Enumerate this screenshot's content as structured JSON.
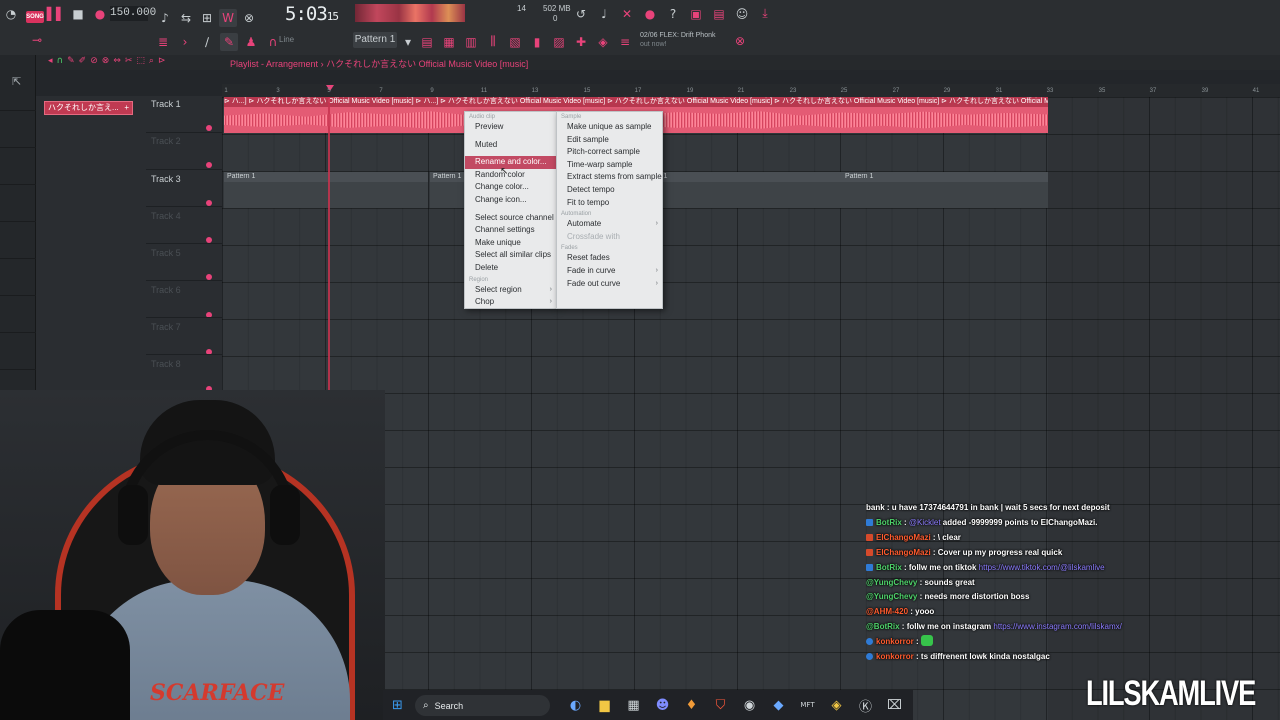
{
  "toolbar": {
    "song_badge": "SONG",
    "tempo": "150.000",
    "time_main": "5:03",
    "time_small": "15",
    "meter_a": "14",
    "meter_b": "502 MB",
    "meter_c": "0",
    "pattern": "Pattern 1",
    "line_mode": "Line",
    "hint_top": "02/06 FLEX: Drift Phonk",
    "hint_bottom": "out now!"
  },
  "playlist": {
    "title_prefix": "Playlist - Arrangement",
    "title_sep": "›",
    "title_song": "ハクそれしか言えない Official Music Video [music]",
    "pattern_picker": "ハクそれしか言え...",
    "pattern_picker_plus": "+"
  },
  "tracks": [
    {
      "label": "Track 1"
    },
    {
      "label": "Track 2"
    },
    {
      "label": "Track 3"
    },
    {
      "label": "Track 4"
    },
    {
      "label": "Track 5"
    },
    {
      "label": "Track 6"
    },
    {
      "label": "Track 7"
    },
    {
      "label": "Track 8"
    }
  ],
  "ruler_ticks": [
    "1",
    "3",
    "5",
    "7",
    "9",
    "11",
    "13",
    "15",
    "17",
    "19",
    "21",
    "23",
    "25",
    "27",
    "29",
    "31",
    "33",
    "35",
    "37",
    "39",
    "41"
  ],
  "audio_clip": {
    "caption": "⊳ ハ...]  ⊳ ハクそれしか言えない Official Music Video [music]  ⊳ ハ...]  ⊳ ハクそれしか言えない Official Music Video [music]  ⊳ ハクそれしか言えない Official Music Video [music]  ⊳ ハクそれしか言えない Official Music Video [music]  ⊳ ハクそれしか言えない Official Music Video [music]"
  },
  "pattern_clips": [
    {
      "label": "Pattern 1"
    },
    {
      "label": "Pattern 1"
    },
    {
      "label": "Pattern 1"
    },
    {
      "label": "Pattern 1"
    }
  ],
  "menu_left": {
    "section_top": "Audio clip",
    "preview": "Preview",
    "muted": "Muted",
    "rename": "Rename and color...",
    "random_color": "Random color",
    "change_color": "Change color...",
    "change_icon": "Change icon...",
    "select_source": "Select source channel",
    "channel_settings": "Channel settings",
    "make_unique": "Make unique",
    "select_similar": "Select all similar clips",
    "delete": "Delete",
    "section_region": "Region",
    "select_region": "Select region",
    "chop": "Chop"
  },
  "menu_right": {
    "section_sample": "Sample",
    "make_unique_sample": "Make unique as sample",
    "edit_sample": "Edit sample",
    "pitch_correct": "Pitch-correct sample",
    "time_warp": "Time-warp sample",
    "extract_stems": "Extract stems from sample",
    "detect_tempo": "Detect tempo",
    "fit_tempo": "Fit to tempo",
    "section_automation": "Automation",
    "automate": "Automate",
    "crossfade": "Crossfade with",
    "section_fades": "Fades",
    "reset_fades": "Reset fades",
    "fade_in": "Fade in curve",
    "fade_out": "Fade out curve"
  },
  "webcam": {
    "shirt_text": "SCARFACE"
  },
  "chat": [
    {
      "user": "bank",
      "text": " : u have 17374644791 in bank | wait 5 secs for next deposit"
    },
    {
      "user": "BotRix",
      "text": " : ",
      "mention": "@Kicklet",
      "rest": " added -9999999 points to ElChangoMazi."
    },
    {
      "user": "ElChangoMazi",
      "text": " : \\ clear"
    },
    {
      "user": "ElChangoMazi",
      "text": " : Cover up my progress real quick"
    },
    {
      "user": "BotRix",
      "text": " : follw me on tiktok ",
      "link": "https://www.tiktok.com/@lilskamlive"
    },
    {
      "user": "@YungChevy",
      "text": " : sounds great"
    },
    {
      "user": "@YungChevy",
      "text": " : needs more distortion boss"
    },
    {
      "user": "@AHM-420",
      "text": " : yooo"
    },
    {
      "user": "@BotRix",
      "text": " : follw me on instagram ",
      "link": "https://www.instagram.com/lilskamx/"
    },
    {
      "user": "konkorror",
      "text": " : "
    },
    {
      "user": "konkorror",
      "text": " : ts diffrenent lowk kinda nostalgac"
    }
  ],
  "taskbar": {
    "search": "Search"
  },
  "watermark": "LILSKAMLIVE",
  "colors": {
    "accent": "#e8437a",
    "clip": "#e45b74",
    "menu_highlight": "#c24a63"
  }
}
